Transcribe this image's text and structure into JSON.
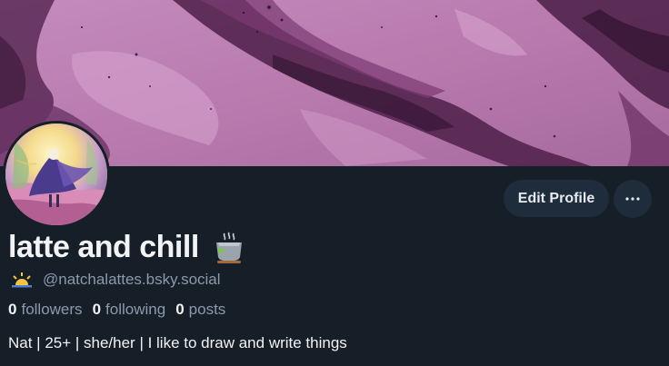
{
  "profile": {
    "display_name": "latte and chill",
    "handle": "@natchalattes.bsky.social",
    "bio": "Nat | 25+ | she/her | I like to draw and write things",
    "stats": [
      {
        "count": "0",
        "label": "followers"
      },
      {
        "count": "0",
        "label": "following"
      },
      {
        "count": "0",
        "label": "posts"
      }
    ]
  },
  "actions": {
    "edit_label": "Edit Profile",
    "more_icon": "ellipsis-icon"
  },
  "icons": {
    "display_name_emoji": "tea-cup-icon",
    "handle_emoji": "sunrise-icon"
  },
  "images": {
    "banner": "purple-watercolor-banner",
    "avatar": "caped-figure-watercolor-avatar"
  },
  "colors": {
    "background": "#161e27",
    "button_bg": "#1f2c3b",
    "primary_text": "#f1f3f5",
    "secondary_text": "#8a9aac",
    "banner_purple": "#b77ab0"
  }
}
